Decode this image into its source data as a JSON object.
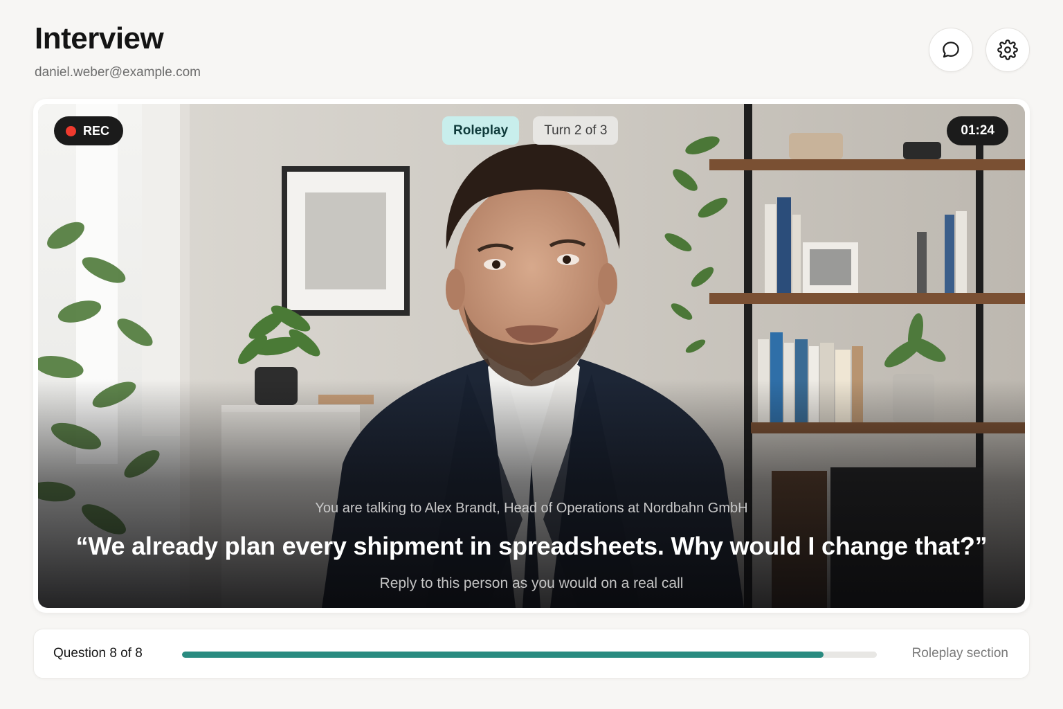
{
  "header": {
    "title": "Interview",
    "email": "daniel.weber@example.com",
    "chat_icon": "chat-bubble-icon",
    "settings_icon": "gear-icon"
  },
  "video": {
    "rec_label": "REC",
    "rec_color": "#ef3a2e",
    "timer": "01:24",
    "mode_chip": "Roleplay",
    "turn_chip": "Turn 2 of 3",
    "context": "You are talking to Alex Brandt, Head of Operations at Nordbahn GmbH",
    "quote": "“We already plan every shipment in spreadsheets. Why would I change that?”",
    "hint": "Reply to this person as you would on a real call"
  },
  "progress": {
    "label": "Question 8 of 8",
    "section": "Roleplay section",
    "fraction": 0.923,
    "color": "#2a8b80"
  }
}
